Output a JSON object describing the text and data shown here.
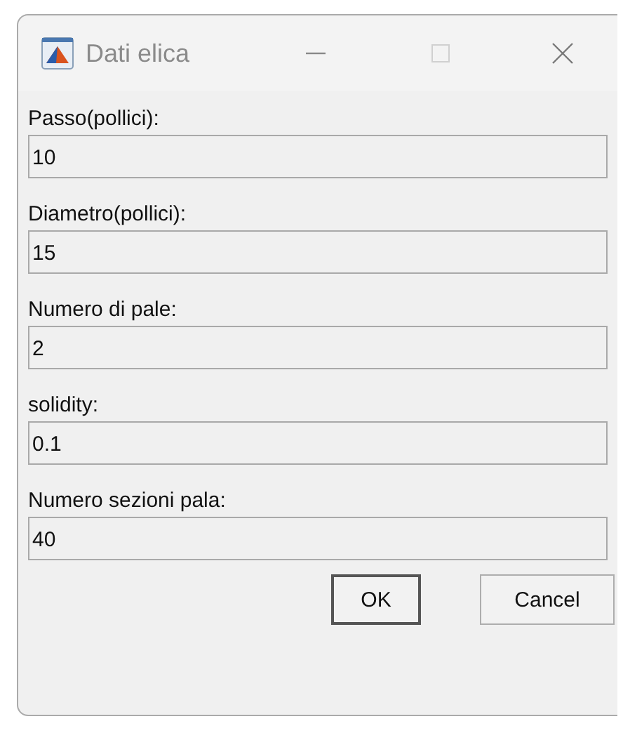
{
  "window": {
    "title": "Dati elica"
  },
  "fields": [
    {
      "label": "Passo(pollici):",
      "value": "10"
    },
    {
      "label": "Diametro(pollici):",
      "value": "15"
    },
    {
      "label": "Numero di pale:",
      "value": "2"
    },
    {
      "label": "solidity:",
      "value": "0.1"
    },
    {
      "label": "Numero sezioni pala:",
      "value": "40"
    }
  ],
  "buttons": [
    {
      "label": "OK",
      "default": true
    },
    {
      "label": "Cancel",
      "default": false
    }
  ]
}
